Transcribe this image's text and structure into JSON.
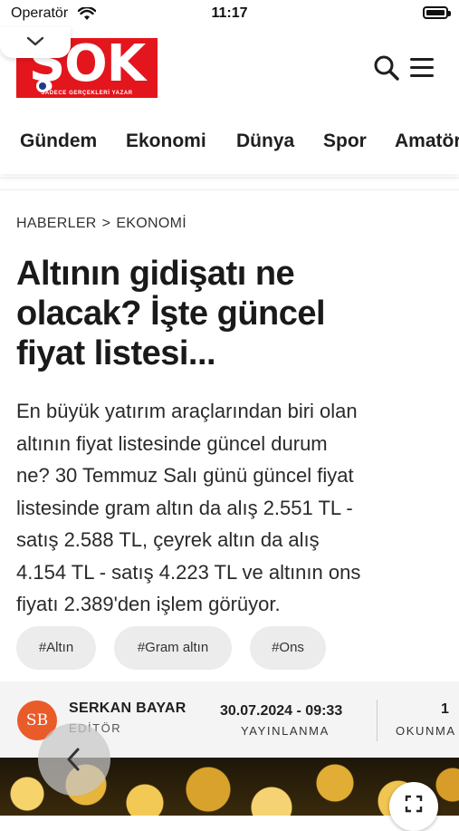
{
  "status_bar": {
    "carrier": "Operatör",
    "time": "11:17",
    "wifi_icon": "wifi-icon",
    "battery_icon": "battery-icon"
  },
  "header": {
    "logo_text": "ŞOK",
    "logo_slogan": "SADECE GERÇEKLERİ YAZAR",
    "brand_color": "#e3161d",
    "search_icon": "search-icon",
    "menu_icon": "menu-icon",
    "collapse_icon": "chevron-down-icon"
  },
  "nav": {
    "items": [
      "Gündem",
      "Ekonomi",
      "Dünya",
      "Spor",
      "Amatör"
    ]
  },
  "breadcrumb": {
    "items": [
      "HABERLER",
      "EKONOMİ"
    ],
    "separator": ">"
  },
  "article": {
    "title_lines": [
      "Altının gidişatı ne",
      "olacak? İşte güncel",
      "fiyat listesi..."
    ],
    "summary_lines": [
      "En büyük yatırım araçlarından biri olan",
      "altının fiyat listesinde güncel durum",
      "ne? 30 Temmuz Salı günü güncel fiyat",
      "listesinde gram altın da alış 2.551 TL -",
      "satış 2.588 TL, çeyrek altın da alış",
      "4.154 TL - satış 4.223 TL ve altının ons",
      "fiyatı 2.389'den işlem görüyor."
    ],
    "tags": [
      "#Altın",
      "#Gram altın",
      "#Ons"
    ]
  },
  "author": {
    "initials": "SB",
    "name": "SERKAN BAYAR",
    "role": "EDİTÖR",
    "avatar_color": "#ea5b2a",
    "published": "30.07.2024 - 09:33",
    "published_label": "YAYINLANMA",
    "read_label": "OKUNMA",
    "read_value": "1"
  },
  "hero": {
    "expand_icon": "expand-icon"
  },
  "floating": {
    "back_icon": "chevron-left-icon"
  }
}
